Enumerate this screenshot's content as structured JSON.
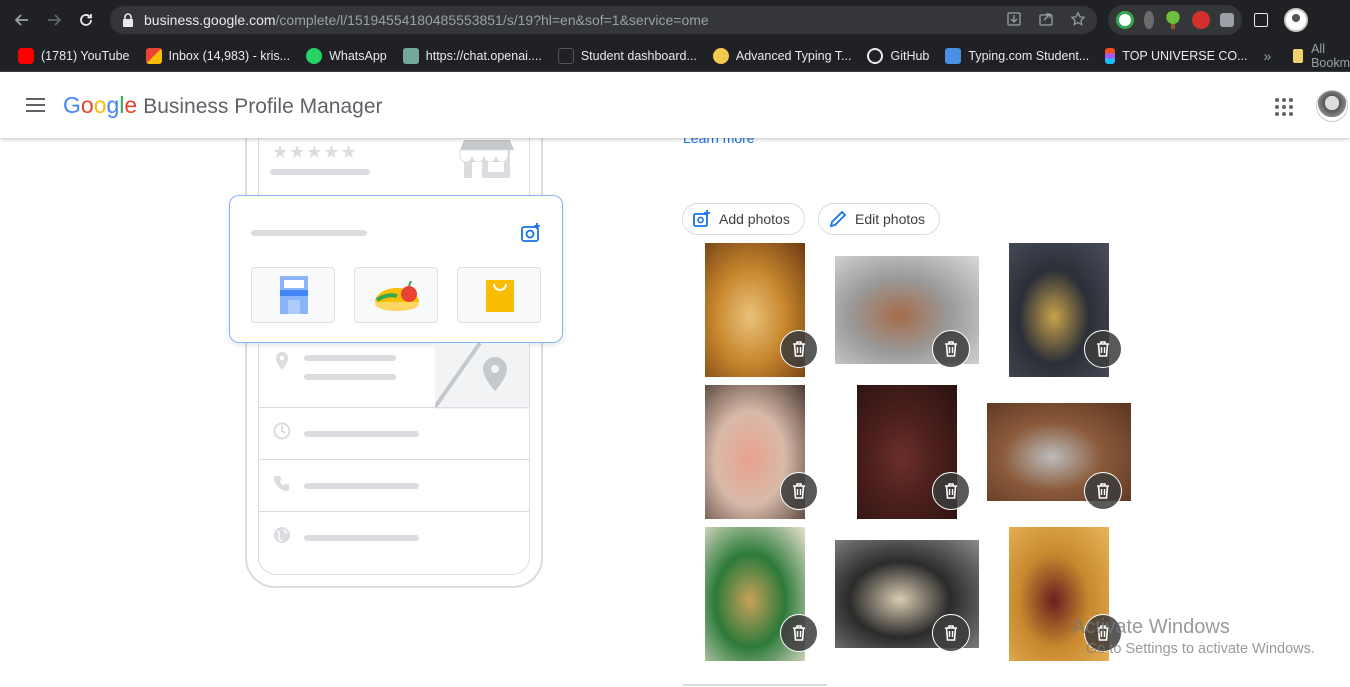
{
  "browser": {
    "url_host": "business.google.com",
    "url_path": "/complete/l/15194554180485553851/s/19?hl=en&sof=1&service=ome",
    "icons": [
      "back-icon",
      "forward-icon",
      "reload-icon",
      "lock-icon",
      "install-icon",
      "share-icon",
      "star-icon",
      "extensions-icon",
      "side-panel-icon"
    ],
    "bookmarks": [
      {
        "label": "(1781) YouTube",
        "icon": "youtube-icon",
        "color": "#ff0000"
      },
      {
        "label": "Inbox (14,983) - kris...",
        "icon": "gmail-icon",
        "color": "#ea4335"
      },
      {
        "label": "WhatsApp",
        "icon": "whatsapp-icon",
        "color": "#25d366"
      },
      {
        "label": "https://chat.openai....",
        "icon": "openai-icon",
        "color": "#74aa9c"
      },
      {
        "label": "Student dashboard...",
        "icon": "dashboard-icon",
        "color": "#555555"
      },
      {
        "label": "Advanced Typing T...",
        "icon": "typing-icon",
        "color": "#f2c94c"
      },
      {
        "label": "GitHub",
        "icon": "github-icon",
        "color": "#e8eaed"
      },
      {
        "label": "Typing.com Student...",
        "icon": "typing-com-icon",
        "color": "#4a90e2"
      },
      {
        "label": "TOP UNIVERSE CO...",
        "icon": "figma-icon",
        "color": "#f24e1e"
      }
    ],
    "more_label": "»",
    "all_bookmarks_label": "All Bookmarks"
  },
  "header": {
    "logo": {
      "G": "G",
      "o1": "o",
      "o2": "o",
      "g": "g",
      "l": "l",
      "e": "e"
    },
    "product_name": "Business Profile Manager"
  },
  "content": {
    "learn_more": "Learn more",
    "add_photos_label": "Add photos",
    "edit_photos_label": "Edit photos",
    "photos": [
      {
        "name": "photo-fried-food",
        "colors": [
          "#c8872e",
          "#e9c27a",
          "#6b3a12"
        ]
      },
      {
        "name": "photo-tray-snacks",
        "colors": [
          "#9a9a9a",
          "#a56b4b",
          "#d9d9d9"
        ]
      },
      {
        "name": "photo-dark-cake",
        "colors": [
          "#2b2f38",
          "#c9a24a",
          "#4a4f5a"
        ]
      },
      {
        "name": "photo-pink-cake",
        "colors": [
          "#d8b9a8",
          "#e9a28e",
          "#4a3a34"
        ]
      },
      {
        "name": "photo-chocolate-bag",
        "colors": [
          "#4a1f1c",
          "#6b2e2a",
          "#2a1110"
        ]
      },
      {
        "name": "photo-foil-cake",
        "colors": [
          "#8a5a3a",
          "#bcbcbc",
          "#5a3520"
        ]
      },
      {
        "name": "photo-gift-basket",
        "colors": [
          "#2d7a3a",
          "#c8a15a",
          "#e9e3d0"
        ]
      },
      {
        "name": "photo-meat-pies",
        "colors": [
          "#2b2b2b",
          "#d8cbb0",
          "#8a8a8a"
        ]
      },
      {
        "name": "photo-peanut-bag",
        "colors": [
          "#c8882e",
          "#6b1f1f",
          "#e9b65a"
        ]
      }
    ],
    "watermark_line1": "Activate Windows",
    "watermark_line2": "Go to Settings to activate Windows."
  },
  "colors": {
    "accent": "#1a73e8",
    "border": "#dadce0",
    "chrome_bg": "#202124"
  }
}
